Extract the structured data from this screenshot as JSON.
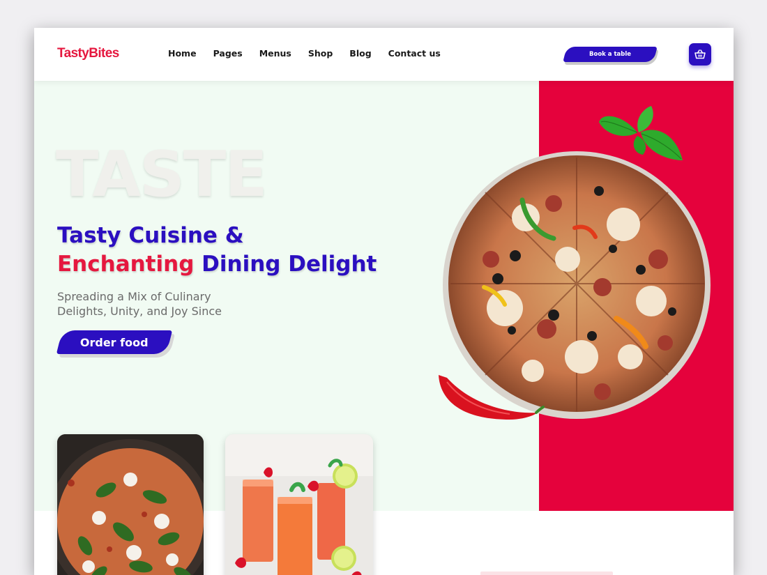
{
  "brand": {
    "logo": "TastyBites",
    "primary": "#2b0fc0",
    "accent": "#e5183f",
    "red_panel": "#e5023c",
    "hero_bg": "#f1fbf3"
  },
  "nav": {
    "items": [
      {
        "label": "Home"
      },
      {
        "label": "Pages"
      },
      {
        "label": "Menus"
      },
      {
        "label": "Shop"
      },
      {
        "label": "Blog"
      },
      {
        "label": "Contact us"
      }
    ],
    "book_label": "Book a table",
    "cart_icon": "basket-icon"
  },
  "hero": {
    "bg_word": "TASTE",
    "headline_line1": "Tasty Cuisine &",
    "headline_line2_red": "Enchanting",
    "headline_line2_blue": " Dining Delight",
    "subtitle": "Spreading a Mix of Culinary Delights, Unity, and Joy Since",
    "cta_label": "Order food",
    "images": [
      "pizza-image",
      "basil-leaves-image",
      "chili-pepper-image"
    ]
  },
  "cards": [
    {
      "image": "spinach-pizza-image"
    },
    {
      "image": "strawberry-drinks-image"
    }
  ]
}
